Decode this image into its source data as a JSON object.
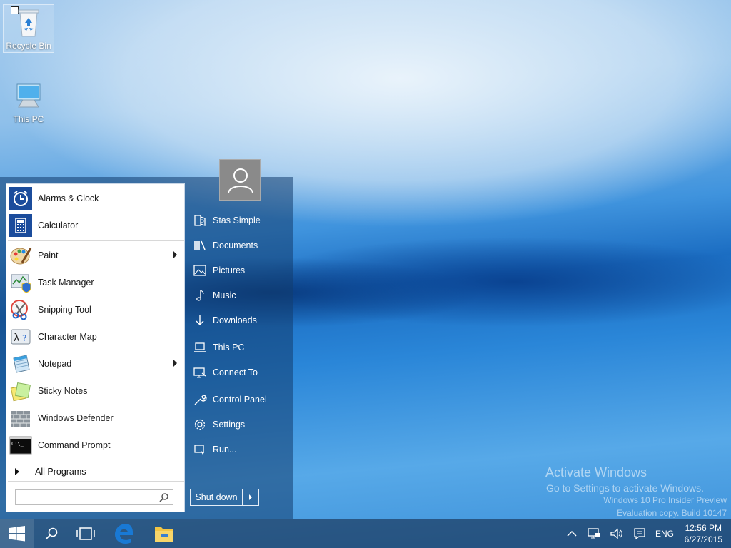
{
  "desktop": {
    "icons": [
      {
        "label": "Recycle Bin",
        "icon": "recycle-bin-icon"
      },
      {
        "label": "This PC",
        "icon": "computer-icon"
      }
    ]
  },
  "start_menu": {
    "pinned_apps": [
      {
        "label": "Alarms & Clock",
        "icon": "alarm-clock-icon"
      },
      {
        "label": "Calculator",
        "icon": "calculator-icon"
      }
    ],
    "recent_apps": [
      {
        "label": "Paint",
        "icon": "paint-palette-icon",
        "submenu": true
      },
      {
        "label": "Task Manager",
        "icon": "task-manager-icon",
        "submenu": false
      },
      {
        "label": "Snipping Tool",
        "icon": "scissors-icon",
        "submenu": false
      },
      {
        "label": "Character Map",
        "icon": "character-map-icon",
        "submenu": false
      },
      {
        "label": "Notepad",
        "icon": "notepad-icon",
        "submenu": true
      },
      {
        "label": "Sticky Notes",
        "icon": "sticky-notes-icon",
        "submenu": false
      },
      {
        "label": "Windows Defender",
        "icon": "defender-wall-icon",
        "submenu": false
      },
      {
        "label": "Command Prompt",
        "icon": "command-prompt-icon",
        "submenu": false
      }
    ],
    "all_programs_label": "All Programs",
    "search": {
      "value": "",
      "placeholder": ""
    },
    "places": [
      {
        "label": "Stas Simple",
        "icon": "user-folder-icon"
      },
      {
        "label": "Documents",
        "icon": "documents-icon"
      },
      {
        "label": "Pictures",
        "icon": "pictures-icon"
      },
      {
        "label": "Music",
        "icon": "music-note-icon"
      },
      {
        "label": "Downloads",
        "icon": "download-arrow-icon"
      },
      {
        "label": "This PC",
        "icon": "laptop-icon"
      },
      {
        "label": "Connect To",
        "icon": "connect-to-icon"
      },
      {
        "label": "Control Panel",
        "icon": "wrench-icon"
      },
      {
        "label": "Settings",
        "icon": "gear-icon"
      },
      {
        "label": "Run...",
        "icon": "run-icon"
      }
    ],
    "shutdown_label": "Shut down"
  },
  "watermark": {
    "line1": "Activate Windows",
    "line2": "Go to Settings to activate Windows.",
    "line3": "Windows 10 Pro Insider Preview",
    "line4": "Evaluation copy. Build 10147"
  },
  "taskbar": {
    "items": [
      "start-button",
      "search-button",
      "task-view-button",
      "edge-browser",
      "file-explorer"
    ],
    "tray": {
      "language": "ENG",
      "time": "12:56 PM",
      "date": "6/27/2015"
    }
  },
  "colors": {
    "accent": "#1e6fb8",
    "start_panel": "#1b4d80",
    "edge_blue": "#1979d4",
    "explorer_yellow": "#f3c544"
  }
}
